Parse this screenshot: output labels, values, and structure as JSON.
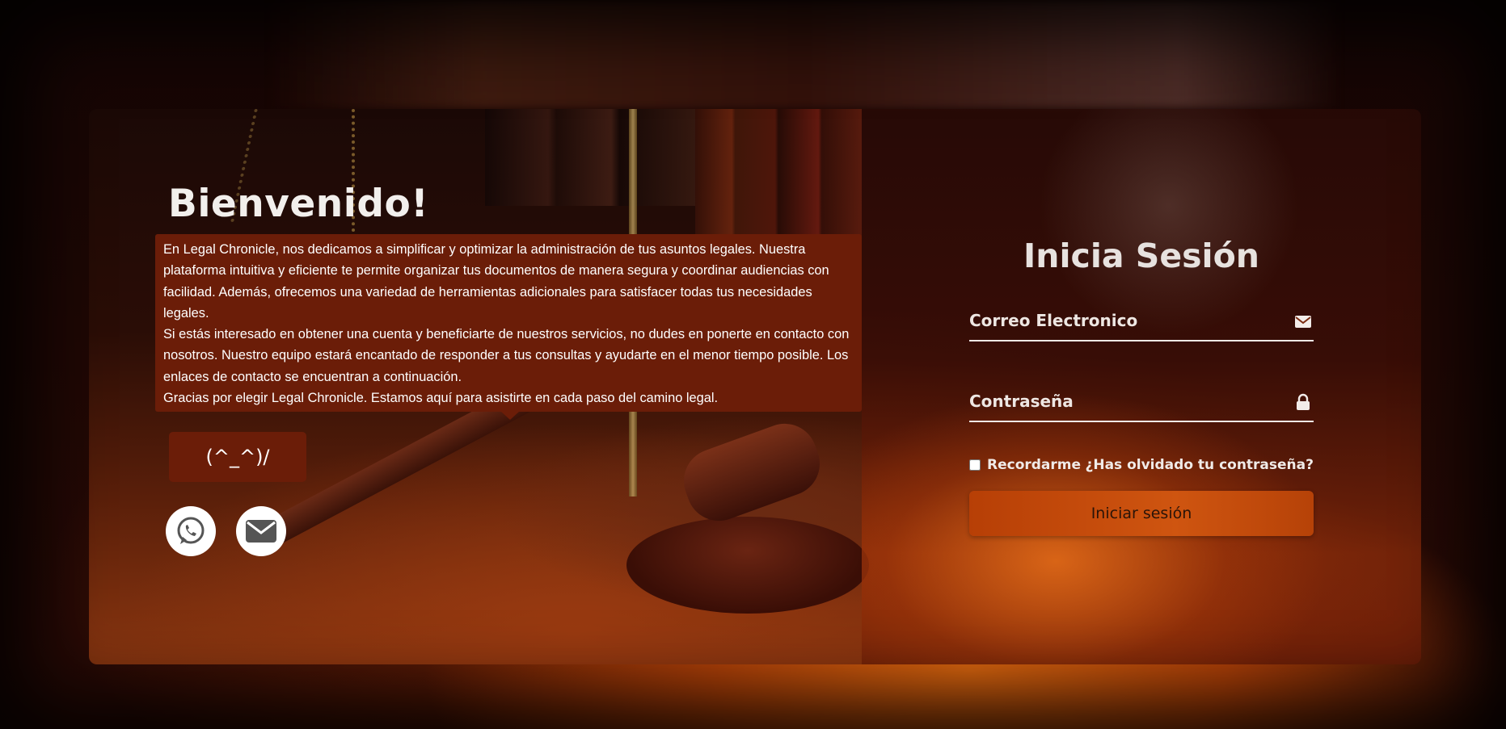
{
  "welcome": {
    "title": "Bienvenido!",
    "paragraphs": [
      "En Legal Chronicle, nos dedicamos a simplificar y optimizar la administración de tus asuntos legales. Nuestra plataforma intuitiva y eficiente te permite organizar tus documentos de manera segura y coordinar audiencias con facilidad. Además, ofrecemos una variedad de herramientas adicionales para satisfacer todas tus necesidades legales.",
      "Si estás interesado en obtener una cuenta y beneficiarte de nuestros servicios, no dudes en ponerte en contacto con nosotros. Nuestro equipo estará encantado de responder a tus consultas y ayudarte en el menor tiempo posible. Los enlaces de contacto se encuentran a continuación.",
      "Gracias por elegir Legal Chronicle. Estamos aquí para asistirte en cada paso del camino legal."
    ],
    "emoticon_button": "(^_^)/",
    "social": [
      "whatsapp-icon",
      "mail-icon"
    ]
  },
  "login": {
    "title": "Inicia Sesión",
    "email_placeholder": "Correo Electronico",
    "password_placeholder": "Contraseña",
    "remember_label": "Recordarme",
    "forgot_link": "¿Has olvidado tu contraseña?",
    "submit_label": "Iniciar sesión"
  },
  "colors": {
    "accent": "#6b1d08",
    "button": "#c44a0b"
  }
}
